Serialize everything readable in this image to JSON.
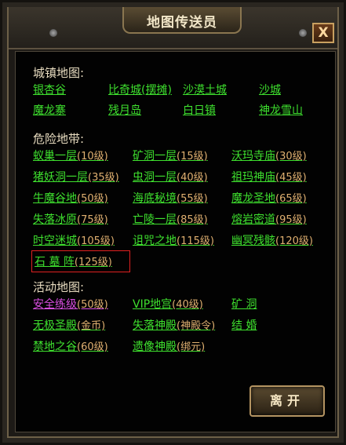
{
  "window": {
    "title": "地图传送员",
    "close_label": "X"
  },
  "town": {
    "title": "城镇地图:",
    "items": [
      {
        "name": "银杏谷"
      },
      {
        "name": "比奇城(摆摊)"
      },
      {
        "name": "沙漠土城"
      },
      {
        "name": "沙城"
      },
      {
        "name": "魔龙寨"
      },
      {
        "name": "残月岛"
      },
      {
        "name": "白日镇"
      },
      {
        "name": "神龙雪山"
      }
    ]
  },
  "danger": {
    "title": "危险地带:",
    "items": [
      {
        "name": "蚁巢一层",
        "level": "(10级)"
      },
      {
        "name": "矿洞一层",
        "level": "(15级)"
      },
      {
        "name": "沃玛寺庙",
        "level": "(30级)"
      },
      {
        "name": "猪妖洞一层",
        "level": "(35级)"
      },
      {
        "name": "虫洞一层",
        "level": "(40级)"
      },
      {
        "name": "祖玛神庙",
        "level": "(45级)"
      },
      {
        "name": "牛魔谷地",
        "level": "(50级)"
      },
      {
        "name": "海底秘境",
        "level": "(55级)"
      },
      {
        "name": "魔龙圣地",
        "level": "(65级)"
      },
      {
        "name": "失落冰原",
        "level": "(75级)"
      },
      {
        "name": "亡陵一层",
        "level": "(85级)"
      },
      {
        "name": "熔岩密道",
        "level": "(95级)"
      },
      {
        "name": "时空迷城",
        "level": "(105级)"
      },
      {
        "name": "诅咒之地",
        "level": "(115级)"
      },
      {
        "name": "幽冥残骸",
        "level": "(120级)"
      },
      {
        "name": "石 墓 阵",
        "level": "(125级)"
      }
    ]
  },
  "event": {
    "title": "活动地图:",
    "items": [
      {
        "name": "安全练级",
        "level": "(50级)"
      },
      {
        "name": "VIP地宫",
        "level": "(40级)"
      },
      {
        "name": "矿  洞",
        "level": ""
      },
      {
        "name": "无极圣殿",
        "level": "(金币)"
      },
      {
        "name": "失落神殿",
        "level": "(神殿令)"
      },
      {
        "name": "结  婚",
        "level": ""
      },
      {
        "name": "禁地之谷",
        "level": "(60级)"
      },
      {
        "name": "遗像神殿",
        "level": "(绑元)"
      }
    ]
  },
  "colors": {
    "link": "#3ee02e",
    "link_alt": "#d84ee0",
    "level": "#e0b070",
    "highlight": "#e02020"
  },
  "footer": {
    "leave_label": "离开"
  }
}
